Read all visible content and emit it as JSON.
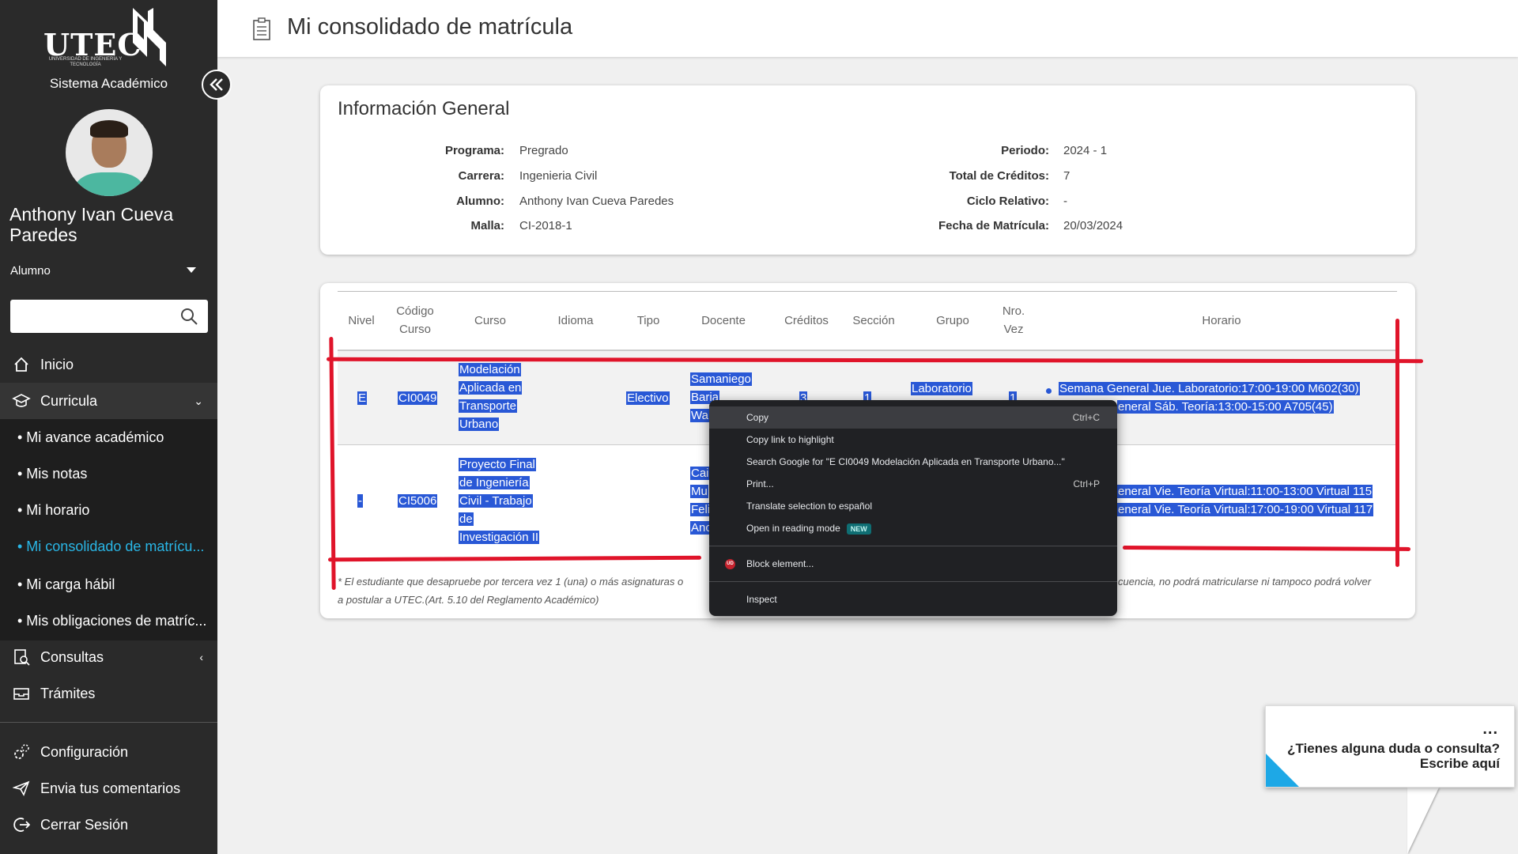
{
  "sidebar": {
    "logo_text": "UTEC",
    "logo_sub": "UNIVERSIDAD DE INGENIERÍA Y TECNOLOGÍA",
    "system_title": "Sistema Académico",
    "user_name": "Anthony Ivan Cueva Paredes",
    "role": "Alumno",
    "search_placeholder": "",
    "nav": {
      "inicio": "Inicio",
      "curricula": "Curricula",
      "sub_avance": "• Mi avance académico",
      "sub_notas": "• Mis notas",
      "sub_horario": "• Mi horario",
      "sub_consolidado": "• Mi consolidado de matrícu...",
      "sub_carga": "• Mi carga hábil",
      "sub_obligaciones": "• Mis obligaciones de matríc...",
      "consultas": "Consultas",
      "tramites": "Trámites",
      "configuracion": "Configuración",
      "comentarios": "Envia tus comentarios",
      "cerrar": "Cerrar Sesión"
    }
  },
  "header": {
    "title": "Mi consolidado de matrícula"
  },
  "info": {
    "title": "Información General",
    "left": [
      {
        "label": "Programa:",
        "value": "Pregrado"
      },
      {
        "label": "Carrera:",
        "value": "Ingenieria Civil"
      },
      {
        "label": "Alumno:",
        "value": "Anthony Ivan Cueva Paredes"
      },
      {
        "label": "Malla:",
        "value": "CI-2018-1"
      }
    ],
    "right": [
      {
        "label": "Periodo:",
        "value": "2024 - 1"
      },
      {
        "label": "Total de Créditos:",
        "value": "7"
      },
      {
        "label": "Ciclo Relativo:",
        "value": "-"
      },
      {
        "label": "Fecha de Matrícula:",
        "value": "20/03/2024"
      }
    ]
  },
  "table": {
    "headers": {
      "nivel": "Nivel",
      "codigo": "Código Curso",
      "curso": "Curso",
      "idioma": "Idioma",
      "tipo": "Tipo",
      "docente": "Docente",
      "creditos": "Créditos",
      "seccion": "Sección",
      "grupo": "Grupo",
      "nro_vez": "Nro. Vez",
      "horario": "Horario"
    },
    "rows": [
      {
        "nivel": "E",
        "codigo": "CI0049",
        "curso": [
          "Modelación",
          "Aplicada en",
          "Transporte",
          "Urbano"
        ],
        "tipo": "Electivo",
        "docente": [
          "Samaniego",
          "Baria",
          "Wa"
        ],
        "creditos": "3",
        "seccion": "1",
        "grupo": "Laboratorio",
        "nro_vez": "1",
        "horario": [
          "Semana General Jue. Laboratorio:17:00-19:00 M602(30)",
          "eneral Sáb. Teoría:13:00-15:00 A705(45)"
        ]
      },
      {
        "nivel": "-",
        "codigo": "CI5006",
        "curso": [
          "Proyecto Final",
          "de Ingeniería",
          "Civil - Trabajo",
          "de",
          "Investigación II"
        ],
        "docente": [
          "Cai",
          "Mu",
          "Feli",
          "Anc"
        ],
        "horario": [
          "eneral Vie. Teoría Virtual:11:00-13:00 Virtual 115",
          "eneral Vie. Teoría Virtual:17:00-19:00 Virtual 117"
        ]
      }
    ],
    "footnote_left": "* El estudiante que desapruebe por tercera vez 1 (una) o más asignaturas o",
    "footnote_right": "cuencia, no podrá matricularse ni tampoco podrá volver",
    "footnote_line2": "a postular a UTEC.(Art. 5.10 del Reglamento Académico)"
  },
  "context_menu": {
    "copy": "Copy",
    "copy_shortcut": "Ctrl+C",
    "copy_link": "Copy link to highlight",
    "search_google": "Search Google for \"E CI0049 Modelación Aplicada en Transporte Urbano...\"",
    "print": "Print...",
    "print_shortcut": "Ctrl+P",
    "translate": "Translate selection to español",
    "reading_mode": "Open in reading mode",
    "new_badge": "NEW",
    "block": "Block element...",
    "ub_icon": "UD",
    "inspect": "Inspect"
  },
  "chat": {
    "dots": "...",
    "line1": "¿Tienes alguna duda o consulta?",
    "line2": "Escribe aquí"
  },
  "colors": {
    "sidebar_bg": "#2a2a2a",
    "active_link": "#29b6e6",
    "selection": "#2958d6",
    "annotation_red": "#e0142a",
    "menu_bg": "#202124",
    "chat_accent": "#1ea8e6"
  }
}
